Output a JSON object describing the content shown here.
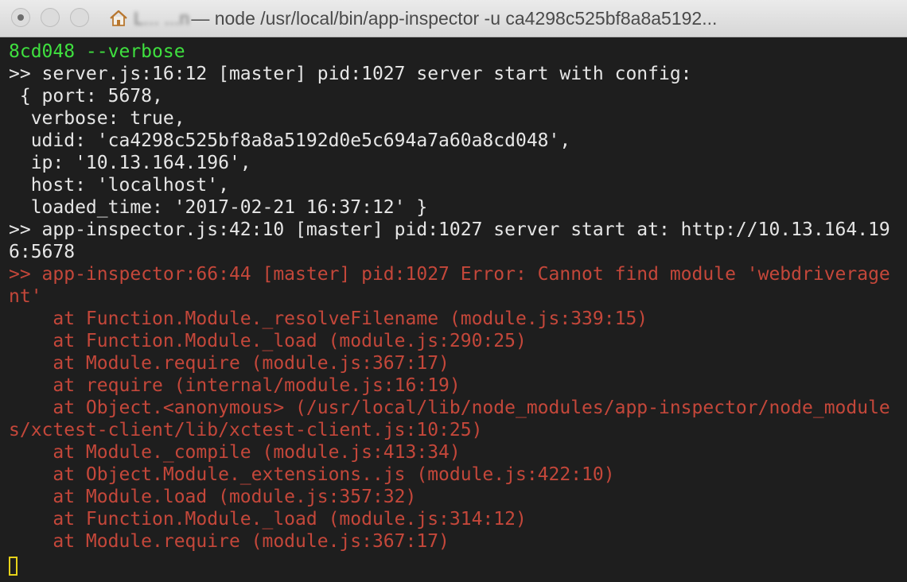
{
  "window": {
    "title_user": "L... ...n",
    "title": "— node /usr/local/bin/app-inspector -u ca4298c525bf8a8a5192..."
  },
  "terminal": {
    "lines": [
      {
        "text": "8cd048 --verbose",
        "color": "green"
      },
      {
        "text": ">> server.js:16:12 [master] pid:1027 server start with config:",
        "color": "white"
      },
      {
        "text": " { port: 5678,",
        "color": "white"
      },
      {
        "text": "  verbose: true,",
        "color": "white"
      },
      {
        "text": "  udid: 'ca4298c525bf8a8a5192d0e5c694a7a60a8cd048',",
        "color": "white"
      },
      {
        "text": "  ip: '10.13.164.196',",
        "color": "white"
      },
      {
        "text": "  host: 'localhost',",
        "color": "white"
      },
      {
        "text": "  loaded_time: '2017-02-21 16:37:12' }",
        "color": "white"
      },
      {
        "text": ">> app-inspector.js:42:10 [master] pid:1027 server start at: http://10.13.164.19",
        "color": "white"
      },
      {
        "text": "6:5678",
        "color": "white"
      },
      {
        "text": ">> app-inspector:66:44 [master] pid:1027 Error: Cannot find module 'webdriverage",
        "color": "red"
      },
      {
        "text": "nt'",
        "color": "red"
      },
      {
        "text": "    at Function.Module._resolveFilename (module.js:339:15)",
        "color": "red"
      },
      {
        "text": "    at Function.Module._load (module.js:290:25)",
        "color": "red"
      },
      {
        "text": "    at Module.require (module.js:367:17)",
        "color": "red"
      },
      {
        "text": "    at require (internal/module.js:16:19)",
        "color": "red"
      },
      {
        "text": "    at Object.<anonymous> (/usr/local/lib/node_modules/app-inspector/node_module",
        "color": "red"
      },
      {
        "text": "s/xctest-client/lib/xctest-client.js:10:25)",
        "color": "red"
      },
      {
        "text": "    at Module._compile (module.js:413:34)",
        "color": "red"
      },
      {
        "text": "    at Object.Module._extensions..js (module.js:422:10)",
        "color": "red"
      },
      {
        "text": "    at Module.load (module.js:357:32)",
        "color": "red"
      },
      {
        "text": "    at Function.Module._load (module.js:314:12)",
        "color": "red"
      },
      {
        "text": "    at Module.require (module.js:367:17)",
        "color": "red"
      }
    ]
  },
  "colors": {
    "green": "#3fe03f",
    "white": "#e6e6e6",
    "red": "#c4473a",
    "background": "#1e1e1e",
    "cursor": "#e6d21a"
  },
  "icons": {
    "close": "close-icon",
    "minimize": "minimize-icon",
    "zoom": "zoom-icon",
    "home": "home-icon",
    "cursor": "cursor-block"
  }
}
